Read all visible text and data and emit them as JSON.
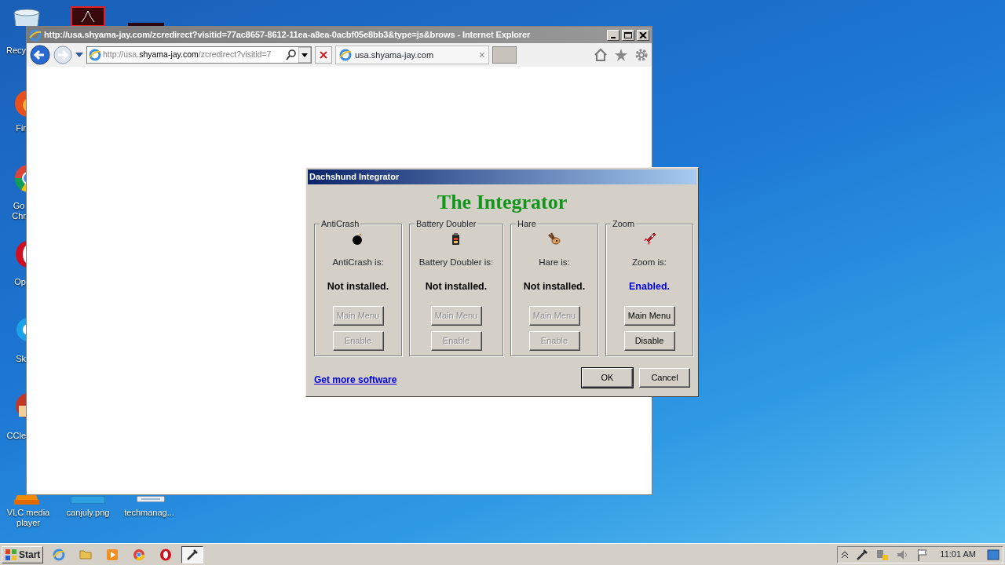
{
  "desktop": {
    "icons": [
      {
        "kind": "recycle",
        "label": "Recy"
      },
      {
        "kind": "firefox",
        "label": "Fir"
      },
      {
        "kind": "chrome",
        "label": "Go\nChr"
      },
      {
        "kind": "opera",
        "label": "Op"
      },
      {
        "kind": "skype",
        "label": "Sk"
      },
      {
        "kind": "ccleaner",
        "label": "CCle"
      },
      {
        "kind": "vlc",
        "label": "VLC media\nplayer"
      },
      {
        "kind": "image",
        "label": "canjuly.png"
      },
      {
        "kind": "document",
        "label": "techmanag..."
      }
    ]
  },
  "browser": {
    "title": "http://usa.shyama-jay.com/zcredirect?visitid=77ac8657-8612-11ea-a8ea-0acbf05e8bb3&type=js&brows - Internet Explorer",
    "address_parts": [
      "http://usa.",
      "shyama-jay.com",
      "/zcredirect?visitid=7"
    ],
    "tab": {
      "label": "usa.shyama-jay.com",
      "close": "×"
    }
  },
  "dialog": {
    "title": "Dachshund Integrator",
    "heading": "The Integrator",
    "panels": [
      {
        "name": "AntiCrash",
        "label": "AntiCrash is:",
        "status": "Not installed.",
        "kind": "missing",
        "buttons": [
          {
            "label": "Main Menu",
            "disabled": true
          },
          {
            "label": "Enable",
            "disabled": true
          }
        ]
      },
      {
        "name": "Battery Doubler",
        "label": "Battery Doubler is:",
        "status": "Not installed.",
        "kind": "missing",
        "buttons": [
          {
            "label": "Main Menu",
            "disabled": true
          },
          {
            "label": "Enable",
            "disabled": true
          }
        ]
      },
      {
        "name": "Hare",
        "label": "Hare is:",
        "status": "Not installed.",
        "kind": "missing",
        "buttons": [
          {
            "label": "Main Menu",
            "disabled": true
          },
          {
            "label": "Enable",
            "disabled": true
          }
        ]
      },
      {
        "name": "Zoom",
        "label": "Zoom is:",
        "status": "Enabled.",
        "kind": "enabled",
        "buttons": [
          {
            "label": "Main Menu",
            "disabled": false
          },
          {
            "label": "Disable",
            "disabled": false
          }
        ]
      }
    ],
    "link": "Get more software",
    "ok": "OK",
    "cancel": "Cancel"
  },
  "taskbar": {
    "start": "Start",
    "apps": [
      {
        "kind": "ie",
        "selected": false
      },
      {
        "kind": "folder",
        "selected": false
      },
      {
        "kind": "media",
        "selected": false
      },
      {
        "kind": "chrome",
        "selected": false
      },
      {
        "kind": "opera",
        "selected": false
      },
      {
        "kind": "tool",
        "selected": true
      }
    ],
    "clock": "11:01 AM"
  }
}
